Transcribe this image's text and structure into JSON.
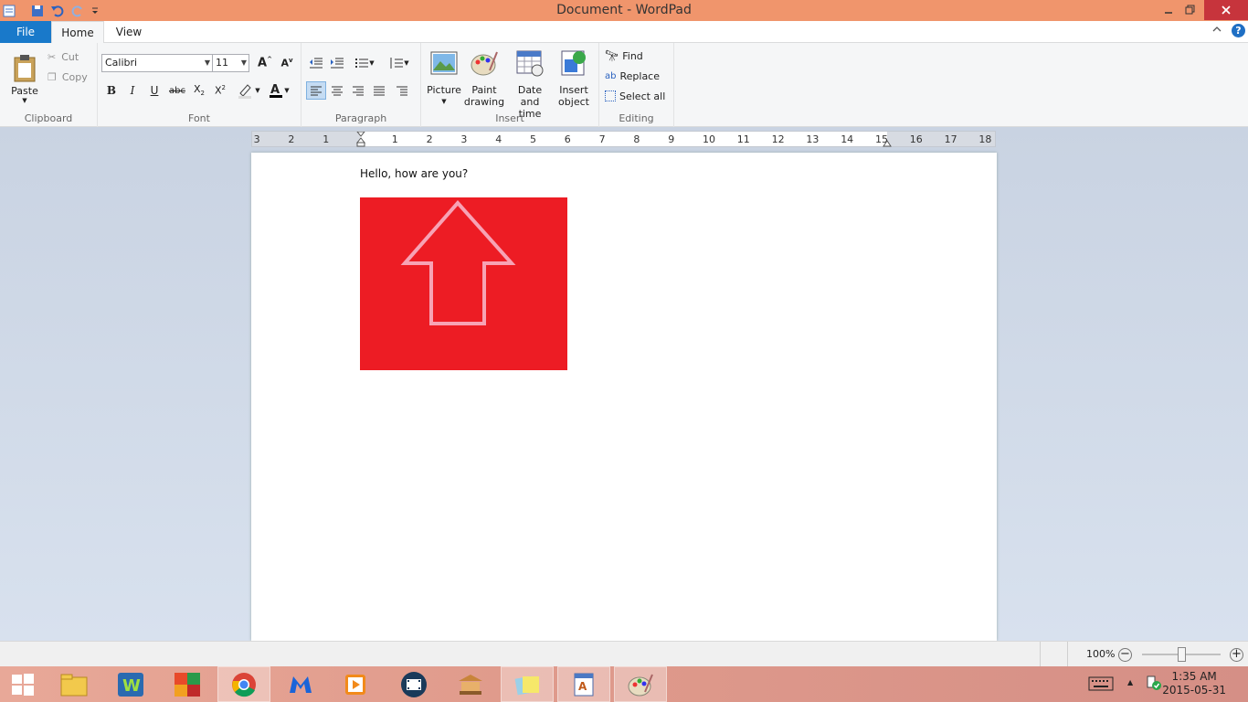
{
  "window": {
    "title": "Document - WordPad"
  },
  "tabs": {
    "file": "File",
    "home": "Home",
    "view": "View"
  },
  "clipboard": {
    "group": "Clipboard",
    "paste": "Paste",
    "cut": "Cut",
    "copy": "Copy"
  },
  "font": {
    "group": "Font",
    "family": "Calibri",
    "size": "11"
  },
  "paragraph": {
    "group": "Paragraph"
  },
  "insert": {
    "group": "Insert",
    "picture": "Picture",
    "paint_line1": "Paint",
    "paint_line2": "drawing",
    "date_line1": "Date and",
    "date_line2": "time",
    "object_line1": "Insert",
    "object_line2": "object"
  },
  "editing": {
    "group": "Editing",
    "find": "Find",
    "replace": "Replace",
    "select_all": "Select all"
  },
  "ruler": {
    "ticks": [
      "3",
      "2",
      "1",
      "1",
      "2",
      "3",
      "4",
      "5",
      "6",
      "7",
      "8",
      "9",
      "10",
      "11",
      "12",
      "13",
      "14",
      "15",
      "16",
      "17",
      "18"
    ]
  },
  "document": {
    "text": "Hello, how are you?"
  },
  "status": {
    "zoom": "100%"
  },
  "clock": {
    "time": "1:35 AM",
    "date": "2015-05-31"
  },
  "colors": {
    "titlebar": "#f0956c",
    "file_tab": "#1979ca",
    "picture_fill": "#ed1c24",
    "arrow_stroke": "#f7a3b5"
  }
}
